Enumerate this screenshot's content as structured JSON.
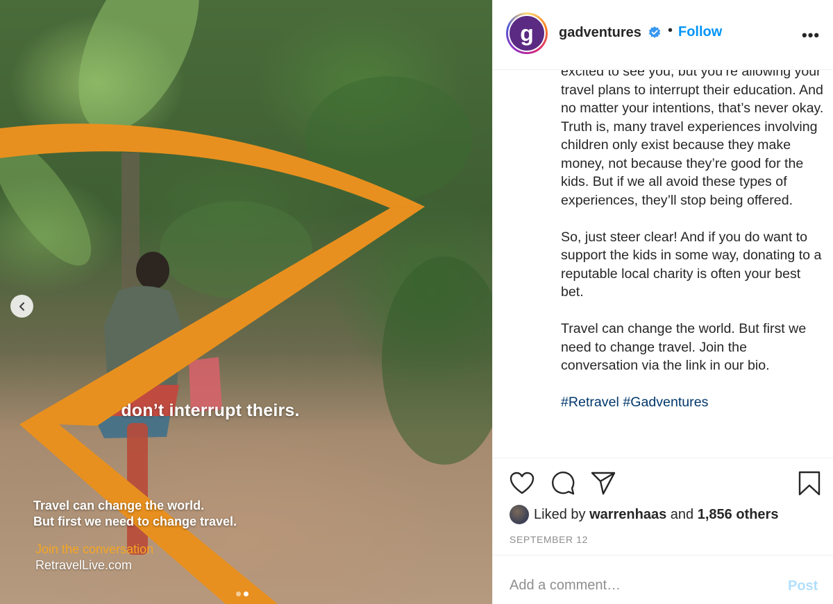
{
  "media": {
    "tagline": "don’t interrupt theirs.",
    "slogan_line1": "Travel can change the world.",
    "slogan_line2": "But first we need to change travel.",
    "join": "Join the conversation",
    "site": "RetravelLive.com",
    "prev_icon": "chevron-left-icon",
    "carousel_total": 2,
    "carousel_active": 2
  },
  "post": {
    "username": "gadventures",
    "avatar_letter": "g",
    "verified": true,
    "separator": "•",
    "follow_label": "Follow",
    "more_label": "•••",
    "caption": {
      "p1": "excited to see you, but you’re allowing your travel plans to interrupt their education. And no matter your intentions, that’s never okay. Truth is, many travel experiences involving children only exist because they make money, not because they’re good for the kids. But if we all avoid these types of experiences, they’ll stop being offered.",
      "p2": "So, just steer clear! And if you do want to support the kids in some way, donating to a reputable local charity is often your best bet.",
      "p3": "Travel can change the world. But first we need to change travel. Join the conversation via the link in our bio.",
      "hashtag1": "#Retravel",
      "hashtag2": "#Gadventures"
    },
    "actions": {
      "like_icon": "heart-icon",
      "comment_icon": "comment-icon",
      "share_icon": "paper-plane-icon",
      "save_icon": "bookmark-icon"
    },
    "likes": {
      "prefix": "Liked by ",
      "user": "warrenhaas",
      "middle": " and ",
      "count": "1,856 others"
    },
    "date": "SEPTEMBER 12",
    "comment_placeholder": "Add a comment…",
    "post_label": "Post"
  },
  "colors": {
    "accent": "#0095f6",
    "banner_orange": "#e8901f",
    "join_text": "#f5a623",
    "hashtag": "#00376b",
    "muted": "#8e8e8e"
  }
}
